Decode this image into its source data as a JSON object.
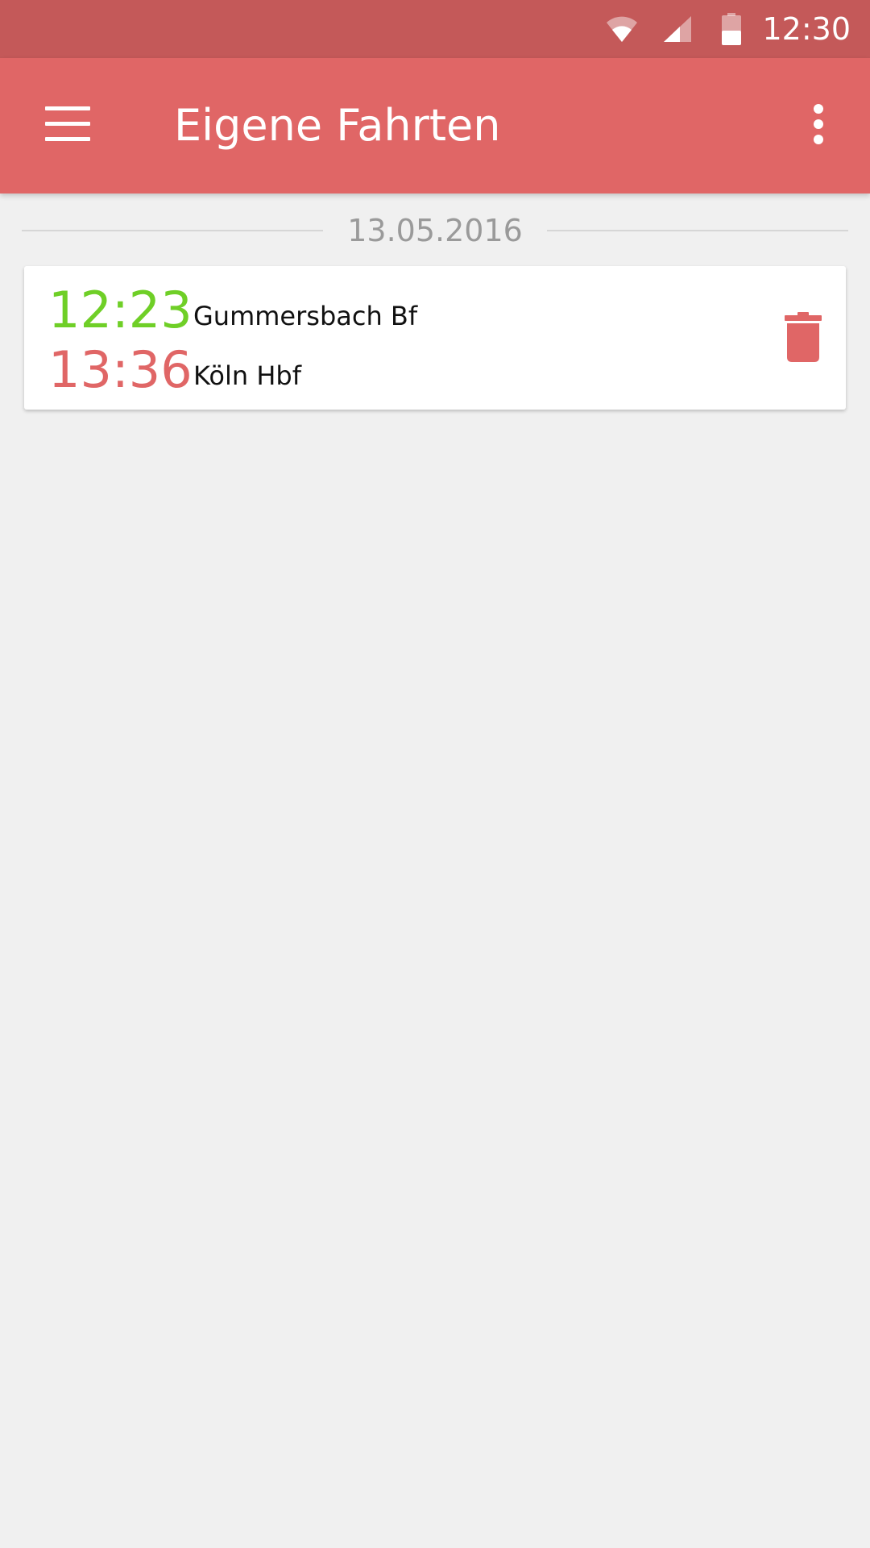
{
  "status_bar": {
    "time": "12:30",
    "icons": [
      "wifi-icon",
      "cell-signal-icon",
      "battery-icon"
    ]
  },
  "app_bar": {
    "title": "Eigene Fahrten",
    "menu_icon": "hamburger-menu-icon",
    "overflow_icon": "more-vert-icon"
  },
  "trips": {
    "date": "13.05.2016",
    "items": [
      {
        "departure_time": "12:23",
        "departure_station": "Gummersbach Bf",
        "arrival_time": "13:36",
        "arrival_station": "Köln Hbf",
        "action_icon": "delete-icon"
      }
    ]
  },
  "colors": {
    "status_bar": "#c45959",
    "app_bar": "#e06666",
    "background": "#f0f0f0",
    "departure_time": "#6fcf27",
    "arrival_time": "#e06666",
    "delete_icon": "#e06666"
  }
}
